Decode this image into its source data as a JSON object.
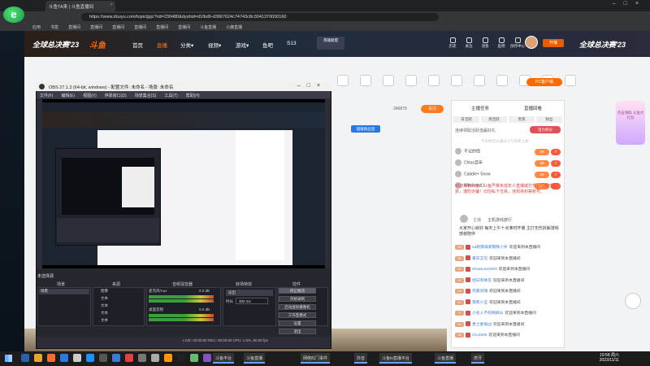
{
  "browser": {
    "tab_title": "斗鱼TA来 | 斗鱼直播间",
    "url": "https://www.douyu.com/topic/jpjc?rid=230480&dyshid=d1fbd9-d3967624c74743c8c3041370000160",
    "bookmarks": [
      "应用",
      "书签",
      "直播间",
      "直播间",
      "直播间",
      "直播间",
      "直播间",
      "直播间",
      "斗鱼直播",
      "小鹿直播"
    ],
    "logo_letter": "e"
  },
  "douyu_header": {
    "brand": "全球总决赛'23",
    "site_logo": "斗鱼",
    "nav": [
      "首页",
      "直播",
      "分类▾",
      "视频▾",
      "游戏▾",
      "鱼吧",
      "S13"
    ],
    "badge_text": "英雄联盟",
    "top_icons": [
      "历史",
      "关注",
      "消息",
      "鱼吧",
      "创作中心"
    ],
    "open_live": "开播",
    "right_brand": "全球总决赛'23"
  },
  "room": {
    "follow_count": "346879",
    "follow_button": "关注",
    "tag_badge": "超级粉丝团",
    "gifts": [
      "",
      "",
      "",
      "",
      "",
      "",
      "",
      "",
      "",
      "",
      ""
    ],
    "pc_client": "PC客户端"
  },
  "right_panel": {
    "tabs": [
      "主播任务",
      "直播回看"
    ],
    "subtabs": [
      "日活跃",
      "周活跃",
      "贵宾",
      "粉丝"
    ],
    "notice_top": "连续领取活跃值赢好礼",
    "benefit_button": "活力积分",
    "rank_hint": "今天你可以通过人气有奖上榜",
    "ranks": [
      {
        "name": "不记的情",
        "lvl": "28",
        "n": "7"
      },
      {
        "name": "China百年",
        "lvl": "28",
        "n": "7"
      },
      {
        "name": "Caddie+ Snow",
        "lvl": "28",
        "n": "7"
      },
      {
        "name": "Windows11",
        "lvl": "28",
        "n": "7"
      }
    ],
    "notice": "欢迎来到斗鱼！斗鱼严禁未成年人直播或打赏，请理性消费，谨防诈骗！切勿私下交易，违规将封禁账号。",
    "owner_title": "主播",
    "owner_name": "主机游戏旅行",
    "owner_msg": "大家开心就好 每天上午十点准时开播 主打无伤拆解游戏 感谢陪伴",
    "chat": [
      {
        "lv": "28",
        "name": "ea刺猬海底钢铁小岁",
        "msg": "欢迎来到本直播间"
      },
      {
        "lv": "30",
        "name": "重庆又见",
        "msg": "欢迎来到本直播间"
      },
      {
        "lv": "25",
        "name": "ShowLee2003",
        "msg": "欢迎来到本直播间"
      },
      {
        "lv": "22",
        "name": "他日有缘见",
        "msg": "欢迎来到本直播间"
      },
      {
        "lv": "19",
        "name": "完美剑魂",
        "msg": "欢迎来到本直播间"
      },
      {
        "lv": "21",
        "name": "我和小丑",
        "msg": "欢迎来到本直播间"
      },
      {
        "lv": "17",
        "name": "小会人不好搞搞乐",
        "msg": "欢迎来到本直播间"
      },
      {
        "lv": "20",
        "name": "勇士委很凶",
        "msg": "欢迎来到本直播间"
      },
      {
        "lv": "18",
        "name": "chu1890",
        "msg": "欢迎来到本直播间"
      }
    ],
    "side_badge": "点击领取 斗鱼大礼包"
  },
  "obs": {
    "title": "OBS 27.1.3 (64-bit, windows) - 配置文件: 未命名 - 场景: 未命名",
    "menu": [
      "文件(F)",
      "编辑(E)",
      "视图(V)",
      "停靠窗口(D)",
      "场景集合(S)",
      "工具(T)",
      "帮助(H)"
    ],
    "scene_label": "未选择源",
    "docks": [
      "场景",
      "来源",
      "音频混音器",
      "转场特效",
      "控件"
    ],
    "scene_item": "场景",
    "sources": [
      "图像",
      "文本",
      "文本",
      "文本",
      "文本"
    ],
    "mixer": [
      {
        "name": "麦克风/Aux",
        "db": "0.0 dB"
      },
      {
        "name": "桌面音频",
        "db": "0.0 dB"
      }
    ],
    "transition": "淡出",
    "duration_label": "时长",
    "duration": "300 ms",
    "controls": [
      "停止推流",
      "开始录制",
      "启动虚拟摄像机",
      "工作室模式",
      "设置",
      "退出"
    ],
    "status": "LIVE: 00:00:00   REC: 00:00:00   CPU: 1.6%, 60.00 fps"
  },
  "taskbar": {
    "apps": [
      "斗鱼平台",
      "斗鱼直播",
      "网络红门事件",
      "抖音",
      "斗鱼tv直播平台",
      "斗鱼直播",
      "虎牙"
    ],
    "time": "19:58 周六",
    "date": "2023/11/11"
  }
}
